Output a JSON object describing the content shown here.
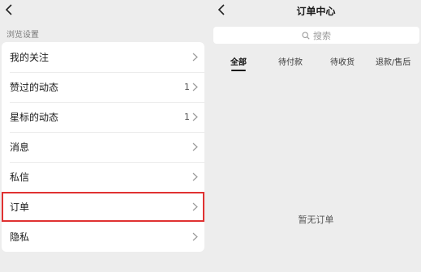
{
  "left": {
    "section_title": "浏览设置",
    "items": [
      {
        "label": "我的关注",
        "count": ""
      },
      {
        "label": "赞过的动态",
        "count": "1"
      },
      {
        "label": "星标的动态",
        "count": "1"
      },
      {
        "label": "消息",
        "count": ""
      },
      {
        "label": "私信",
        "count": ""
      },
      {
        "label": "订单",
        "count": ""
      },
      {
        "label": "隐私",
        "count": ""
      }
    ]
  },
  "right": {
    "title": "订单中心",
    "search_placeholder": "搜索",
    "tabs": [
      {
        "label": "全部"
      },
      {
        "label": "待付款"
      },
      {
        "label": "待收货"
      },
      {
        "label": "退款/售后"
      }
    ],
    "empty_text": "暂无订单"
  },
  "colors": {
    "highlight": "#e03131",
    "background": "#ededed"
  }
}
